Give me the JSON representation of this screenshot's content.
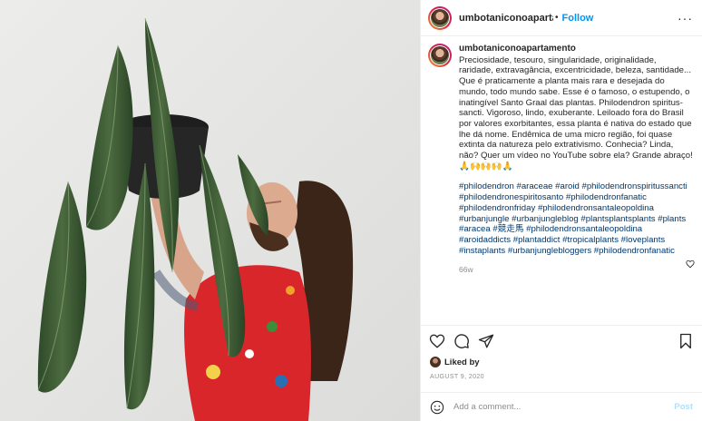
{
  "post": {
    "username": "umbotaniconoapartamento",
    "header_username": "umbotaniconoapartame",
    "separator": "•",
    "follow_label": "Follow",
    "more_label": "···"
  },
  "caption": {
    "username": "umbotaniconoapartamento",
    "text": "Preciosidade, tesouro, singularidade, originalidade, raridade, extravagância, excentricidade, beleza, santidade... Que é praticamente a planta mais rara e desejada do mundo, todo mundo sabe. Esse é o famoso, o estupendo, o inatingível Santo Graal das plantas. Philodendron spiritus-sancti. Vigoroso, lindo, exuberante. Leiloado fora do Brasil por valores exorbitantes, essa planta é nativa do estado que lhe dá nome. Endêmica de uma micro região, foi quase extinta da natureza pelo extrativismo. Conhecia? Linda, não? Quer um vídeo no YouTube sobre ela? Grande abraço!\n🙏🙌🙌🙌🙏",
    "hashtags": "#philodendron #araceae #aroid #philodendronspiritussancti #philodendronespiritosanto #philodendronfanatic #philodendronfriday #philodendronsantaleopoldina #urbanjungle #urbanjungleblog #plantsplantsplants #plants #aracea #競走馬 #philodendronsantaleopoldina #aroidaddicts #plantaddict #tropicalplants #loveplants #instaplants #urbanjunglebloggers #philodendronfanatic",
    "age": "66w"
  },
  "likes": {
    "label": "Liked by"
  },
  "date": "AUGUST 9, 2020",
  "comment": {
    "placeholder": "Add a comment...",
    "post_label": "Post"
  },
  "icons": {
    "heart": "heart-icon",
    "comment": "comment-icon",
    "share": "share-icon",
    "save": "bookmark-icon",
    "emoji": "emoji-icon"
  },
  "colors": {
    "accent": "#0095f6",
    "hashtag": "#00376b",
    "muted": "#8e8e8e",
    "post_disabled": "#b2dffc"
  }
}
